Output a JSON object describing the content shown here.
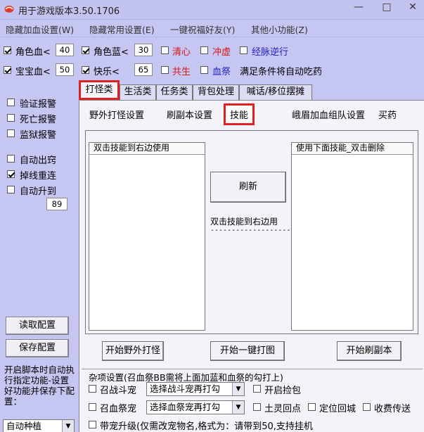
{
  "window": {
    "title": "用于游戏版本3.50.1706",
    "minimize": "—",
    "maximize": "□",
    "close": "✕"
  },
  "menu": [
    "隐藏加血设置(W)",
    "隐藏常用设置(E)",
    "一键祝福好友(Y)",
    "其他小功能(Z)"
  ],
  "top_options": {
    "hp_label": "角色血<",
    "hp_value": "40",
    "mp_label": "角色蓝<",
    "mp_value": "30",
    "qingxin": "清心",
    "chongxu": "冲虚",
    "jingmai": "经脉逆行",
    "pet_hp_label": "宝宝血<",
    "pet_hp_value": "50",
    "happy_label": "快乐<",
    "happy_value": "65",
    "gongsheng": "共生",
    "xueji": "血祭",
    "auto_potion_note": "满足条件将自动吃药"
  },
  "left_panel": {
    "verify_alarm": "验证报警",
    "death_alarm": "死亡报警",
    "jail_alarm": "监狱报警",
    "auto_leave": "自动出窍",
    "reconnect": "掉线重连",
    "auto_level": "自动升到",
    "level_value": "89",
    "read_config": "读取配置",
    "save_config": "保存配置",
    "note": "开启脚本时自动执行指定功能-设置好功能并保存下配置：",
    "dropdown": "自动种植"
  },
  "tabs_main": [
    "打怪类",
    "生活类",
    "任务类",
    "背包处理",
    "喊话/移位摆摊"
  ],
  "tabs_sub": [
    "野外打怪设置",
    "刷副本设置",
    "技能",
    "峨眉加血",
    "组队设置",
    "买药"
  ],
  "skills": {
    "left_header": "双击技能到右边使用",
    "right_header": "使用下面技能_双击删除",
    "refresh": "刷新",
    "hint": "双击技能到右边用",
    "arrow": "------------------->>"
  },
  "actions": {
    "start_field": "开始野外打怪",
    "start_one_click": "开始一键打图",
    "start_dungeon": "开始刷副本"
  },
  "misc": {
    "title": "杂项设置(召血祭BB需将上面加蓝和血祭的勾打上)",
    "summon_fight": "召战斗宠",
    "summon_fight_select": "选择战斗宠再打勾",
    "pickup": "开启捡包",
    "summon_blood": "召血祭宠",
    "summon_blood_select": "选择血祭宠再打勾",
    "earth_return": "土灵回点",
    "fixed_return": "定位回城",
    "collect_fee": "收费传送",
    "pet_upgrade": "带宠升级(仅需改宠物名,格式为：请带到50,支持挂机"
  },
  "colors": {
    "window_bg": "#c6c6f2",
    "panel_bg": "#f3f3f9",
    "highlight": "#e02020",
    "red_text": "#d81818",
    "blue_text": "#1f1fc8"
  }
}
